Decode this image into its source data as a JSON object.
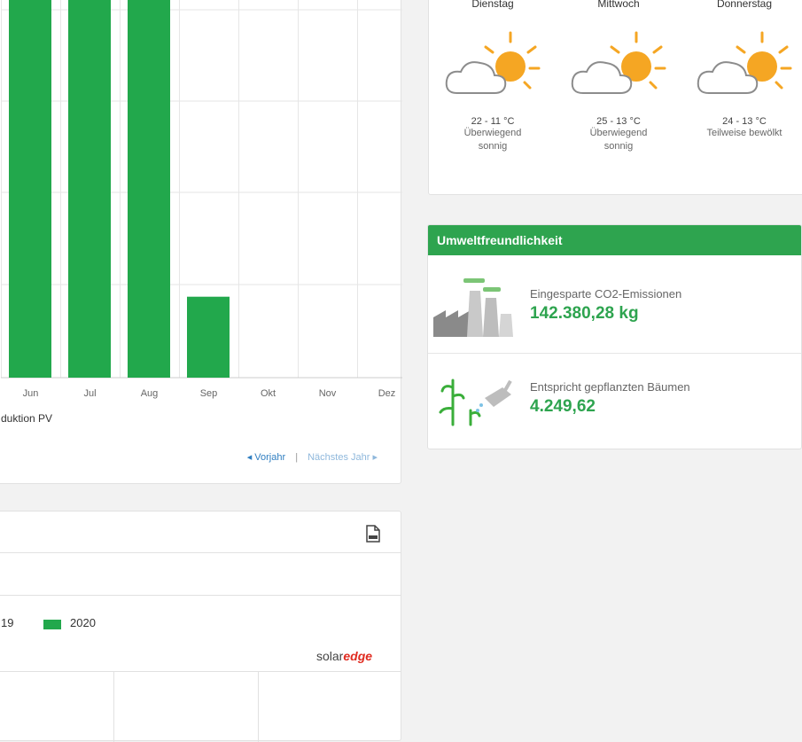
{
  "production_chart": {
    "legend_label": "duktion PV",
    "bar_color": "#22a84c",
    "nav": {
      "prev": "◂ Vorjahr",
      "separator": "|",
      "next": "Nächstes Jahr ▸"
    }
  },
  "chart_data": {
    "type": "bar",
    "categories": [
      "Jun",
      "Jul",
      "Aug",
      "Sep",
      "Okt",
      "Nov",
      "Dez"
    ],
    "series": [
      {
        "name": "duktion PV",
        "values": [
          1,
          1,
          1,
          0.22,
          0,
          0,
          0
        ]
      }
    ]
  },
  "weather": {
    "days": [
      {
        "name": "Dienstag",
        "temp": "22 - 11 °C",
        "desc_line1": "Überwiegend",
        "desc_line2": "sonnig",
        "icon": "partly-sunny-icon"
      },
      {
        "name": "Mittwoch",
        "temp": "25 - 13 °C",
        "desc_line1": "Überwiegend",
        "desc_line2": "sonnig",
        "icon": "partly-sunny-icon"
      },
      {
        "name": "Donnerstag",
        "temp": "24 - 13 °C",
        "desc_line1": "Teilweise bewölkt",
        "desc_line2": "",
        "icon": "partly-cloudy-icon"
      }
    ]
  },
  "environment": {
    "title": "Umweltfreundlichkeit",
    "co2_label": "Eingesparte CO2-Emissionen",
    "co2_value": "142.380,28 kg",
    "trees_label": "Entspricht gepflanzten Bäumen",
    "trees_value": "4.249,62",
    "accent_color": "#2ea44f"
  },
  "bottom_chart": {
    "legend_prev": "19",
    "legend_current": "2020",
    "current_color": "#22a84c",
    "brand_part1": "solar",
    "brand_part2": "edge",
    "icon": "document-icon"
  }
}
